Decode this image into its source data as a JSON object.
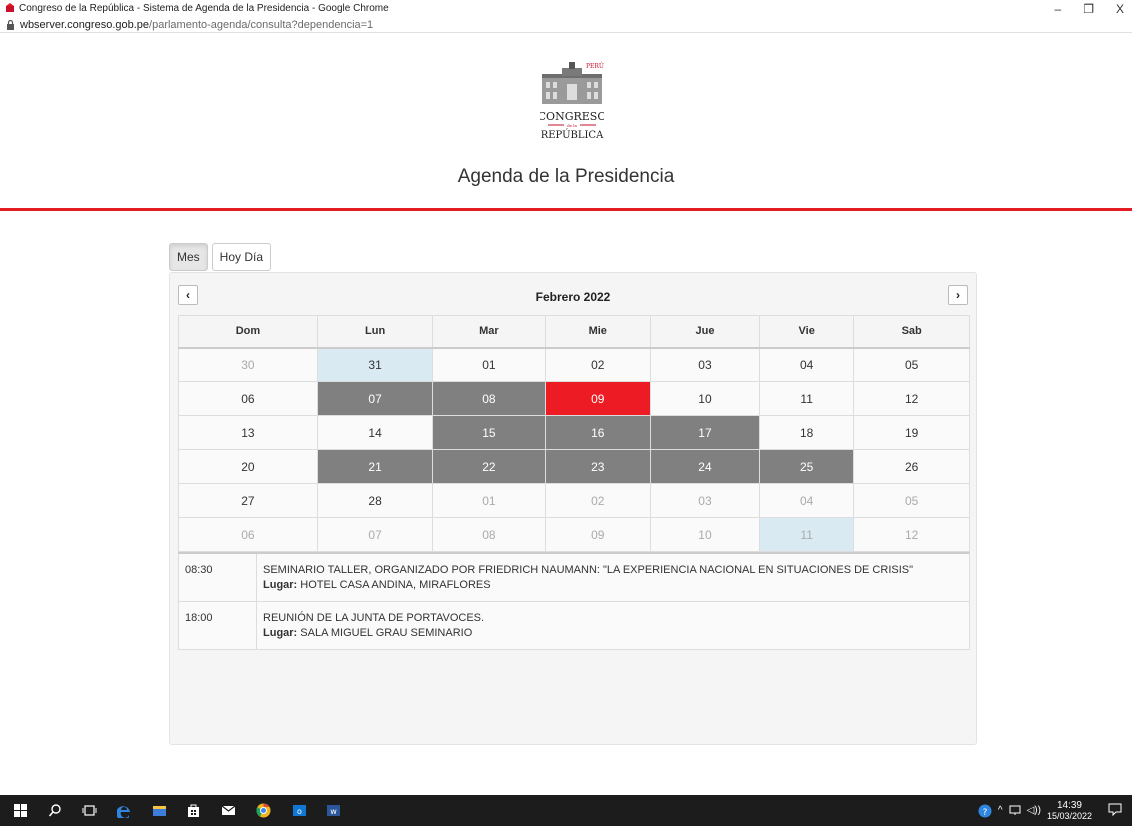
{
  "browser": {
    "window_title": "Congreso de la República - Sistema de Agenda de la Presidencia - Google Chrome",
    "url_host": "wbserver.congreso.gob.pe",
    "url_path": "/parlamento-agenda/consulta?dependencia=1",
    "controls": {
      "minimize": "–",
      "restore": "❐",
      "close": "X"
    }
  },
  "header": {
    "logo_text_top": "PERÚ",
    "logo_text_main": "CONGRESO",
    "logo_text_small": "de la",
    "logo_text_bottom": "REPÚBLICA",
    "title": "Agenda de la Presidencia",
    "accent_color": "#e31b23"
  },
  "tabs": [
    {
      "label": "Mes",
      "active": true
    },
    {
      "label": "Hoy Día",
      "active": false
    }
  ],
  "calendar": {
    "month_title": "Febrero 2022",
    "prev_icon": "‹",
    "next_icon": "›",
    "weekdays": [
      "Dom",
      "Lun",
      "Mar",
      "Mie",
      "Jue",
      "Vie",
      "Sab"
    ],
    "weeks": [
      [
        {
          "d": "30",
          "s": "other"
        },
        {
          "d": "31",
          "s": "today"
        },
        {
          "d": "01",
          "s": ""
        },
        {
          "d": "02",
          "s": ""
        },
        {
          "d": "03",
          "s": ""
        },
        {
          "d": "04",
          "s": ""
        },
        {
          "d": "05",
          "s": ""
        }
      ],
      [
        {
          "d": "06",
          "s": ""
        },
        {
          "d": "07",
          "s": "busy"
        },
        {
          "d": "08",
          "s": "busy"
        },
        {
          "d": "09",
          "s": "selected"
        },
        {
          "d": "10",
          "s": ""
        },
        {
          "d": "11",
          "s": ""
        },
        {
          "d": "12",
          "s": ""
        }
      ],
      [
        {
          "d": "13",
          "s": ""
        },
        {
          "d": "14",
          "s": ""
        },
        {
          "d": "15",
          "s": "busy"
        },
        {
          "d": "16",
          "s": "busy"
        },
        {
          "d": "17",
          "s": "busy"
        },
        {
          "d": "18",
          "s": ""
        },
        {
          "d": "19",
          "s": ""
        }
      ],
      [
        {
          "d": "20",
          "s": ""
        },
        {
          "d": "21",
          "s": "busy"
        },
        {
          "d": "22",
          "s": "busy"
        },
        {
          "d": "23",
          "s": "busy"
        },
        {
          "d": "24",
          "s": "busy"
        },
        {
          "d": "25",
          "s": "busy"
        },
        {
          "d": "26",
          "s": ""
        }
      ],
      [
        {
          "d": "27",
          "s": ""
        },
        {
          "d": "28",
          "s": ""
        },
        {
          "d": "01",
          "s": "other"
        },
        {
          "d": "02",
          "s": "other"
        },
        {
          "d": "03",
          "s": "other"
        },
        {
          "d": "04",
          "s": "other"
        },
        {
          "d": "05",
          "s": "other"
        }
      ],
      [
        {
          "d": "06",
          "s": "other"
        },
        {
          "d": "07",
          "s": "other"
        },
        {
          "d": "08",
          "s": "other"
        },
        {
          "d": "09",
          "s": "other"
        },
        {
          "d": "10",
          "s": "other"
        },
        {
          "d": "11",
          "s": "other today"
        },
        {
          "d": "12",
          "s": "other"
        }
      ]
    ],
    "colors": {
      "busy": "#808080",
      "selected": "#ed1c24",
      "today": "#d9eaf3"
    }
  },
  "events": [
    {
      "time": "08:30",
      "title": "SEMINARIO TALLER, ORGANIZADO POR FRIEDRICH NAUMANN: \"LA EXPERIENCIA NACIONAL EN SITUACIONES DE CRISIS\"",
      "location_label": "Lugar:",
      "location": "HOTEL CASA ANDINA, MIRAFLORES"
    },
    {
      "time": "18:00",
      "title": "REUNIÓN DE LA JUNTA DE PORTAVOCES.",
      "location_label": "Lugar:",
      "location": "SALA MIGUEL GRAU SEMINARIO"
    }
  ],
  "taskbar": {
    "icons": [
      "windows-start-icon",
      "search-icon",
      "task-view-icon",
      "edge-icon",
      "file-explorer-icon",
      "store-icon",
      "mail-icon",
      "chrome-icon",
      "outlook-icon",
      "word-icon"
    ],
    "time": "14:39",
    "date": "15/03/2022"
  }
}
